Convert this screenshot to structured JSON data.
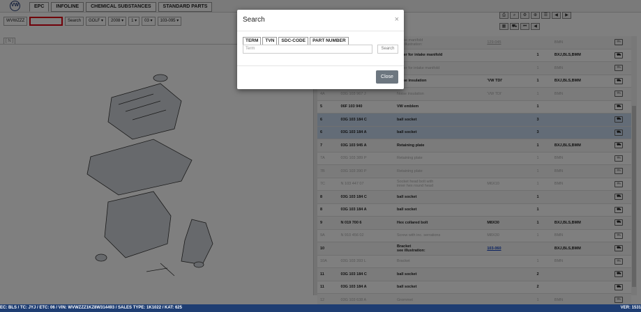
{
  "app": {
    "logo_text": "VW"
  },
  "tabs": [
    {
      "label": "EPC"
    },
    {
      "label": "INFOLINE"
    },
    {
      "label": "CHEMICAL SUBSTANCES"
    },
    {
      "label": "STANDARD PARTS"
    }
  ],
  "search_bar": {
    "vin_prefix": "WVWZZZ",
    "input_value": "",
    "search_label": "Search",
    "model": "GOLF",
    "year": "2008",
    "group": "1",
    "subgroup": "03",
    "graphic": "103-095"
  },
  "left_panel": {
    "view_label": "[ N ]"
  },
  "parts": [
    {
      "pos": "",
      "part_no": "",
      "description": "Intake manifold\nsee illustration:",
      "remark": "",
      "link": "129-045",
      "qty": "",
      "model": "BMN",
      "grey": true,
      "hl": false
    },
    {
      "pos": "",
      "part_no": "",
      "description": "cover for intake manifold",
      "remark": "",
      "link": "",
      "qty": "1",
      "model": "BXJ,BLS,BMM",
      "grey": false,
      "hl": false
    },
    {
      "pos": "",
      "part_no": "",
      "description": "Cover for intake manifold",
      "remark": "",
      "link": "",
      "qty": "1",
      "model": "BMN",
      "grey": true,
      "hl": false
    },
    {
      "pos": "",
      "part_no": "",
      "description": "Noise insulation",
      "remark": "'VW     TDI'",
      "link": "",
      "qty": "1",
      "model": "BXJ,BLS,BMM",
      "grey": false,
      "hl": false
    },
    {
      "pos": "4A",
      "part_no": "03G 103 967 J",
      "description": "Noise insulation",
      "remark": "'VW     TDI'",
      "link": "",
      "qty": "1",
      "model": "BMN",
      "grey": true,
      "hl": false
    },
    {
      "pos": "5",
      "part_no": "06F 103 940",
      "description": "VW emblem",
      "remark": "",
      "link": "",
      "qty": "1",
      "model": "",
      "grey": false,
      "hl": false
    },
    {
      "pos": "6",
      "part_no": "03G 103 184 C",
      "description": "ball socket",
      "remark": "",
      "link": "",
      "qty": "3",
      "model": "",
      "grey": false,
      "hl": true
    },
    {
      "pos": "6",
      "part_no": "03G 103 184 A",
      "description": "ball socket",
      "remark": "",
      "link": "",
      "qty": "3",
      "model": "",
      "grey": false,
      "hl": true
    },
    {
      "pos": "7",
      "part_no": "03G 103 945 A",
      "description": "Retaining plate",
      "remark": "",
      "link": "",
      "qty": "1",
      "model": "BXJ,BLS,BMM",
      "grey": false,
      "hl": false
    },
    {
      "pos": "7A",
      "part_no": "03G 103 389 P",
      "description": "Retaining plate",
      "remark": "",
      "link": "",
      "qty": "1",
      "model": "BMN",
      "grey": true,
      "hl": false
    },
    {
      "pos": "7B",
      "part_no": "03G 103 390 P",
      "description": "Retaining plate",
      "remark": "",
      "link": "",
      "qty": "1",
      "model": "BMN",
      "grey": true,
      "hl": false
    },
    {
      "pos": "7C",
      "part_no": "N  103 447 07",
      "description": "Socket head bolt with\ninner hex round head",
      "remark": "M6X10",
      "link": "",
      "qty": "1",
      "model": "BMN",
      "grey": true,
      "hl": false
    },
    {
      "pos": "8",
      "part_no": "03G 103 184 C",
      "description": "ball socket",
      "remark": "",
      "link": "",
      "qty": "1",
      "model": "",
      "grey": false,
      "hl": false
    },
    {
      "pos": "8",
      "part_no": "03G 103 184 A",
      "description": "ball socket",
      "remark": "",
      "link": "",
      "qty": "1",
      "model": "",
      "grey": false,
      "hl": false
    },
    {
      "pos": "9",
      "part_no": "N  019 700 6",
      "description": "Hex collared bolt",
      "remark": "M8X30",
      "link": "",
      "qty": "1",
      "model": "BXJ,BLS,BMM",
      "grey": false,
      "hl": false
    },
    {
      "pos": "9A",
      "part_no": "N  910 456 02",
      "description": "Screw with inc. serrations",
      "remark": "M8X30",
      "link": "",
      "qty": "1",
      "model": "BMN",
      "grey": true,
      "hl": false
    },
    {
      "pos": "10",
      "part_no": "",
      "description": "Bracket\nsee illustration:",
      "remark": "",
      "link": "103-060",
      "qty": "",
      "model": "BXJ,BLS,BMM",
      "grey": false,
      "hl": false
    },
    {
      "pos": "10A",
      "part_no": "03G 103 393 L",
      "description": "Bracket",
      "remark": "",
      "link": "",
      "qty": "1",
      "model": "BMN",
      "grey": true,
      "hl": false
    },
    {
      "pos": "11",
      "part_no": "03G 103 184 C",
      "description": "ball socket",
      "remark": "",
      "link": "",
      "qty": "2",
      "model": "",
      "grey": false,
      "hl": false
    },
    {
      "pos": "11",
      "part_no": "03G 103 184 A",
      "description": "ball socket",
      "remark": "",
      "link": "",
      "qty": "2",
      "model": "",
      "grey": false,
      "hl": false
    },
    {
      "pos": "12",
      "part_no": "03G 103 638 A",
      "description": "Grommet",
      "remark": "",
      "link": "",
      "qty": "1",
      "model": "BMN",
      "grey": true,
      "hl": false
    }
  ],
  "status_bar": {
    "left": "EC: BLS / TC: JYJ / ETC: 06 / VIN: WVWZZZ1KZ8W314493 / SALES TYPE: 1K1022 / KAT: 625",
    "right": "VER: 1531"
  },
  "modal": {
    "title": "Search",
    "close_glyph": "×",
    "tabs": [
      {
        "label": "TERM"
      },
      {
        "label": "TVN"
      },
      {
        "label": "SDC-CODE"
      },
      {
        "label": "PART NUMBER"
      }
    ],
    "term_placeholder": "Term",
    "search_label": "Search",
    "close_label": "Close"
  }
}
